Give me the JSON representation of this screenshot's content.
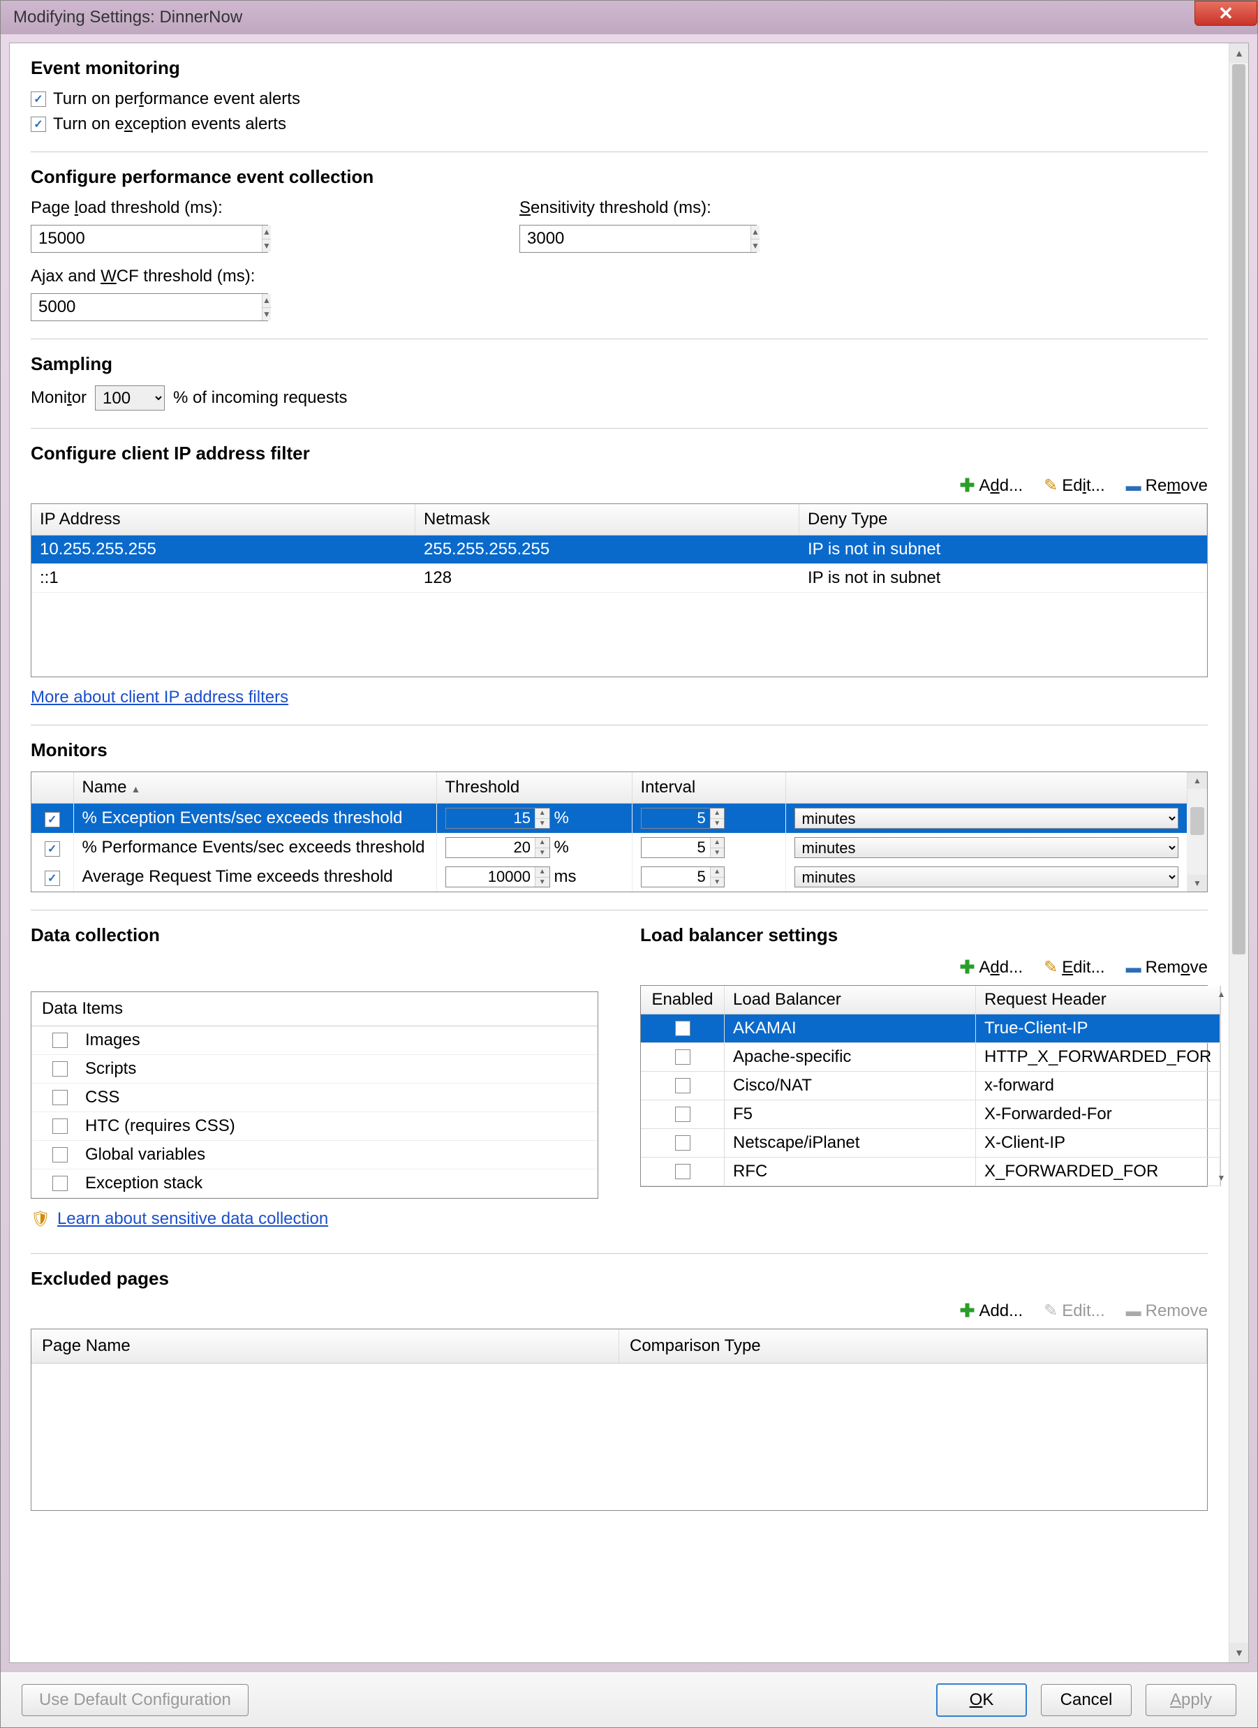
{
  "window": {
    "title": "Modifying Settings: DinnerNow",
    "close": "✕"
  },
  "eventMonitoring": {
    "heading": "Event monitoring",
    "perfAlerts": "Turn on performance event alerts",
    "excAlerts": "Turn on exception events alerts",
    "perfChecked": true,
    "excChecked": true
  },
  "perfCollection": {
    "heading": "Configure performance event collection",
    "pageLoadLabel": "Page load threshold (ms):",
    "pageLoadValue": "15000",
    "sensitivityLabel": "Sensitivity threshold (ms):",
    "sensitivityValue": "3000",
    "ajaxLabel": "Ajax and WCF threshold (ms):",
    "ajaxValue": "5000"
  },
  "sampling": {
    "heading": "Sampling",
    "monitorLabel": "Monitor",
    "value": "100",
    "suffix": "% of incoming requests"
  },
  "ipFilter": {
    "heading": "Configure client IP address filter",
    "addLabel": "Add...",
    "editLabel": "Edit...",
    "removeLabel": "Remove",
    "headers": {
      "ip": "IP Address",
      "netmask": "Netmask",
      "deny": "Deny Type"
    },
    "rows": [
      {
        "ip": "10.255.255.255",
        "netmask": "255.255.255.255",
        "deny": "IP is not in subnet",
        "selected": true
      },
      {
        "ip": "::1",
        "netmask": "128",
        "deny": "IP is not in subnet",
        "selected": false
      }
    ],
    "link": "More about client IP address filters"
  },
  "monitors": {
    "heading": "Monitors",
    "headers": {
      "name": "Name",
      "threshold": "Threshold",
      "interval": "Interval"
    },
    "rows": [
      {
        "name": "% Exception Events/sec exceeds threshold",
        "threshold": "15",
        "tunit": "%",
        "interval": "5",
        "iunit": "minutes",
        "checked": true,
        "selected": true
      },
      {
        "name": "% Performance Events/sec exceeds threshold",
        "threshold": "20",
        "tunit": "%",
        "interval": "5",
        "iunit": "minutes",
        "checked": true,
        "selected": false
      },
      {
        "name": "Average Request Time exceeds threshold",
        "threshold": "10000",
        "tunit": "ms",
        "interval": "5",
        "iunit": "minutes",
        "checked": true,
        "selected": false
      }
    ]
  },
  "dataCollection": {
    "heading": "Data collection",
    "itemsHeader": "Data Items",
    "items": [
      {
        "label": "Images",
        "checked": false
      },
      {
        "label": "Scripts",
        "checked": false
      },
      {
        "label": "CSS",
        "checked": false
      },
      {
        "label": "HTC (requires CSS)",
        "checked": false
      },
      {
        "label": "Global variables",
        "checked": false
      },
      {
        "label": "Exception stack",
        "checked": false
      }
    ],
    "link": "Learn about sensitive data collection"
  },
  "loadBalancer": {
    "heading": "Load balancer settings",
    "addLabel": "Add...",
    "editLabel": "Edit...",
    "removeLabel": "Remove",
    "headers": {
      "enabled": "Enabled",
      "name": "Load Balancer",
      "header": "Request Header"
    },
    "rows": [
      {
        "checked": false,
        "name": "AKAMAI",
        "header": "True-Client-IP",
        "selected": true
      },
      {
        "checked": false,
        "name": "Apache-specific",
        "header": "HTTP_X_FORWARDED_FOR",
        "selected": false
      },
      {
        "checked": false,
        "name": "Cisco/NAT",
        "header": "x-forward",
        "selected": false
      },
      {
        "checked": false,
        "name": "F5",
        "header": "X-Forwarded-For",
        "selected": false
      },
      {
        "checked": false,
        "name": "Netscape/iPlanet",
        "header": "X-Client-IP",
        "selected": false
      },
      {
        "checked": false,
        "name": "RFC",
        "header": "X_FORWARDED_FOR",
        "selected": false
      }
    ]
  },
  "excluded": {
    "heading": "Excluded pages",
    "addLabel": "Add...",
    "editLabel": "Edit...",
    "removeLabel": "Remove",
    "headers": {
      "page": "Page Name",
      "comp": "Comparison Type"
    }
  },
  "footer": {
    "defaultCfg": "Use Default Configuration",
    "ok": "OK",
    "cancel": "Cancel",
    "apply": "Apply"
  }
}
